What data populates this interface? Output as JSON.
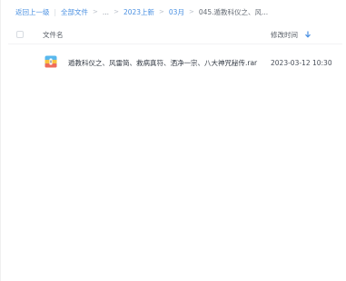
{
  "breadcrumb": {
    "back_label": "返回上一级",
    "all_files_label": "全部文件",
    "ellipsis": "...",
    "folder_2023": "2023上新",
    "folder_month": "03月",
    "current": "045.遁教科仪之、风..."
  },
  "table": {
    "columns": {
      "name": "文件名",
      "modified": "修改时间"
    },
    "rows": [
      {
        "name": "遁教科仪之、风雷简、救病真符、洒净一宗、八大神咒秘传.rar",
        "modified": "2023-03-12 10:30",
        "icon": "rar-archive-icon"
      }
    ]
  },
  "colors": {
    "link": "#4a90e2",
    "sort_arrow": "#4a90e2"
  }
}
